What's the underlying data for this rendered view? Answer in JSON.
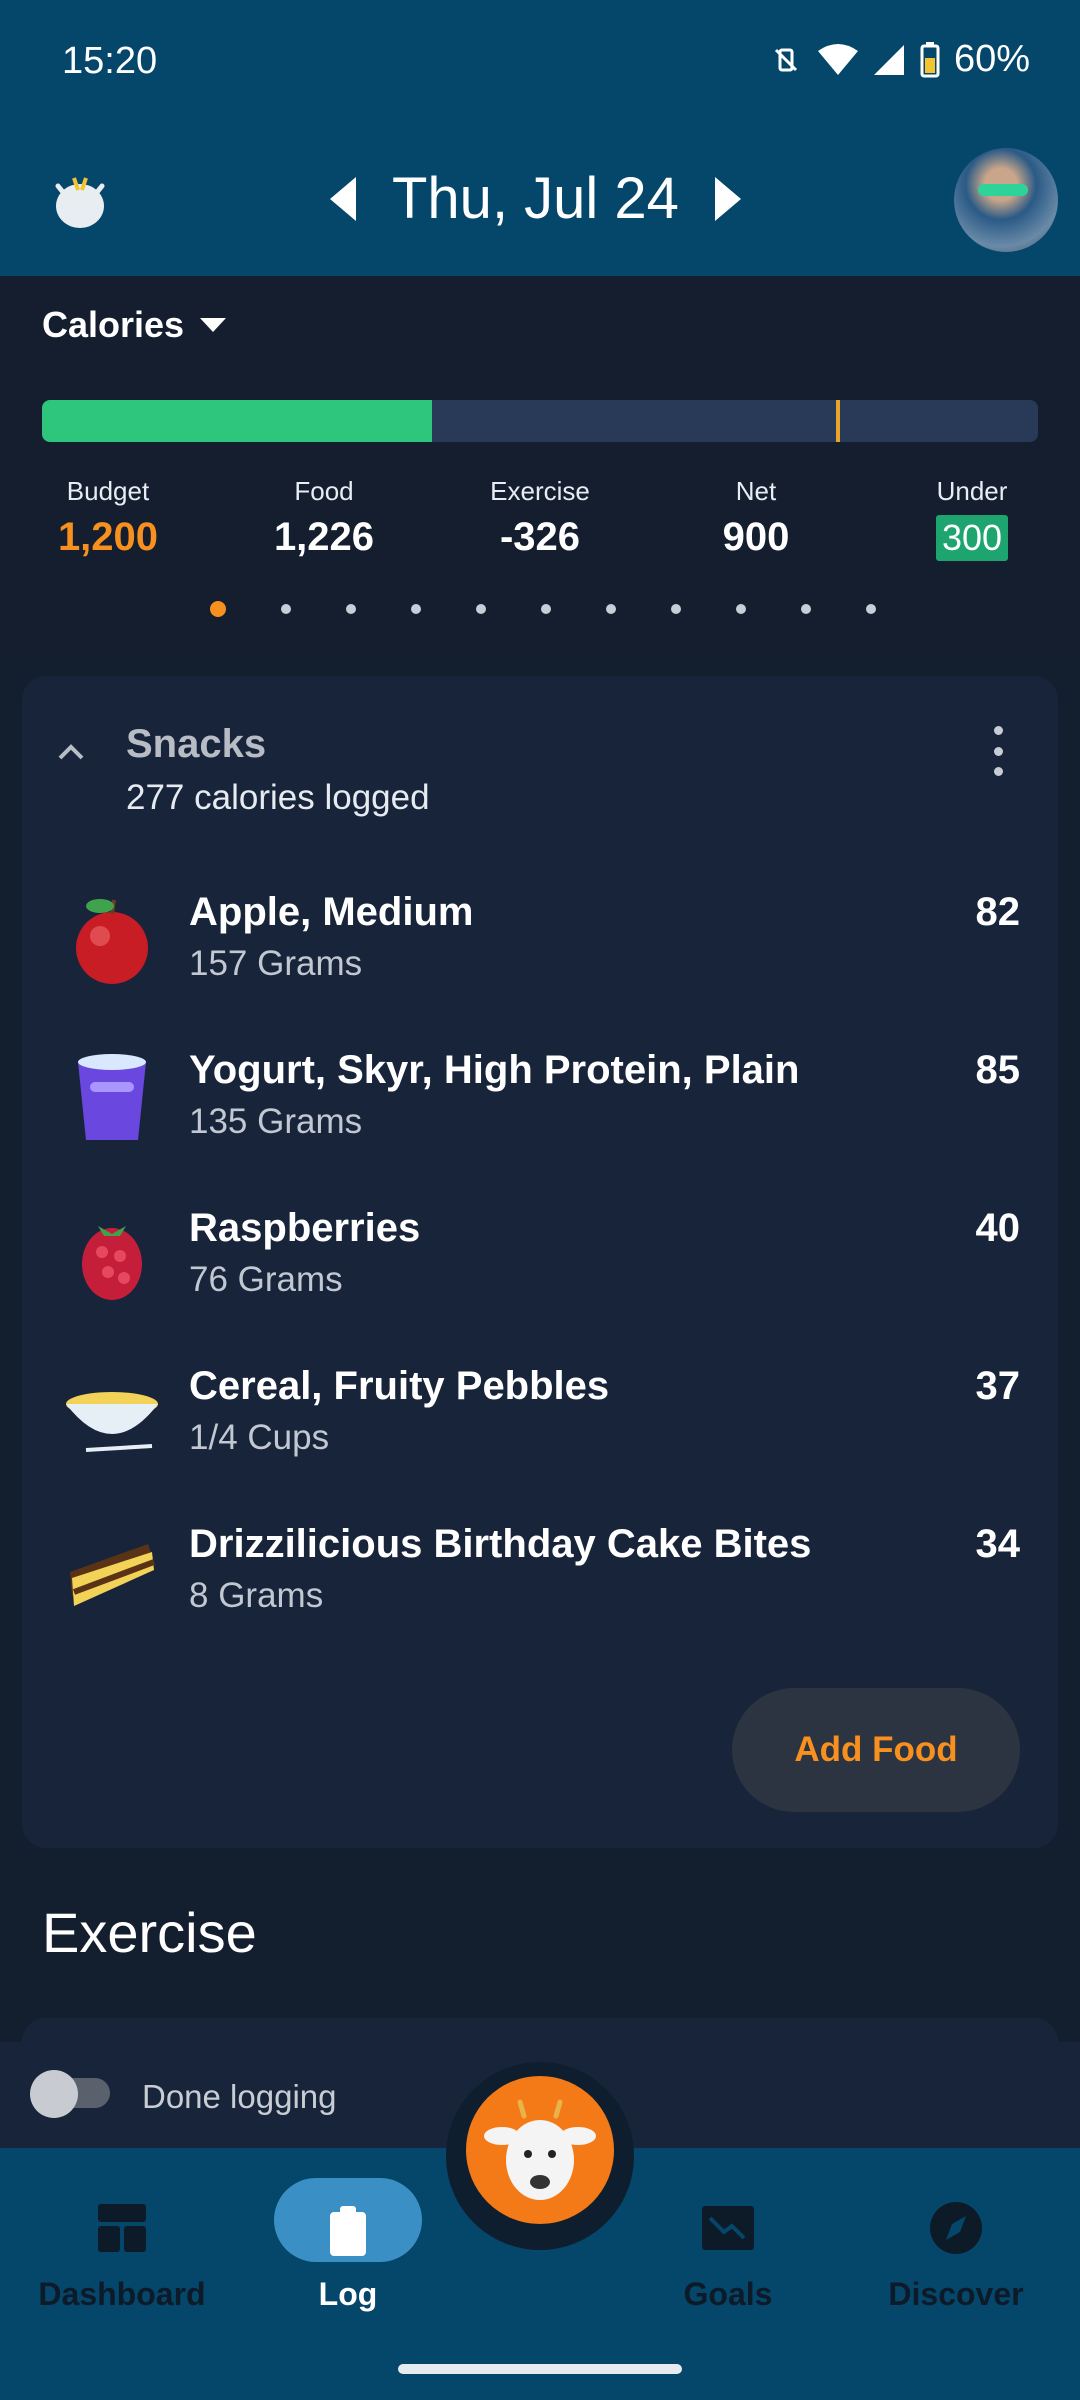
{
  "status_bar": {
    "time": "15:20",
    "battery": "60%"
  },
  "header": {
    "date": "Thu, Jul 24"
  },
  "summary": {
    "metric": "Calories",
    "progress_fraction": 0.392,
    "stats": [
      {
        "label": "Budget",
        "value": "1,200"
      },
      {
        "label": "Food",
        "value": "1,226"
      },
      {
        "label": "Exercise",
        "value": "-326"
      },
      {
        "label": "Net",
        "value": "900"
      },
      {
        "label": "Under",
        "value": "300"
      }
    ],
    "pages": 11,
    "active_page": 0
  },
  "snacks": {
    "title": "Snacks",
    "subtitle": "277 calories logged",
    "items": [
      {
        "name": "Apple, Medium",
        "qty": "157 Grams",
        "cal": "82",
        "icon": "apple-icon"
      },
      {
        "name": "Yogurt, Skyr, High Protein, Plain",
        "qty": "135 Grams",
        "cal": "85",
        "icon": "yogurt-icon"
      },
      {
        "name": "Raspberries",
        "qty": "76 Grams",
        "cal": "40",
        "icon": "raspberry-icon"
      },
      {
        "name": "Cereal, Fruity Pebbles",
        "qty": "1/4 Cups",
        "cal": "37",
        "icon": "cereal-bowl-icon"
      },
      {
        "name": "Drizzilicious Birthday Cake Bites",
        "qty": "8 Grams",
        "cal": "34",
        "icon": "cake-slice-icon"
      }
    ],
    "add_food": "Add Food"
  },
  "exercise": {
    "title": "Exercise"
  },
  "done_logging": {
    "label": "Done logging",
    "on": false
  },
  "nav": {
    "dashboard": "Dashboard",
    "log": "Log",
    "goals": "Goals",
    "discover": "Discover"
  },
  "colors": {
    "accent": "#f7901e",
    "header": "#05466b",
    "progress": "#2ec67d",
    "background": "#131e2f"
  }
}
